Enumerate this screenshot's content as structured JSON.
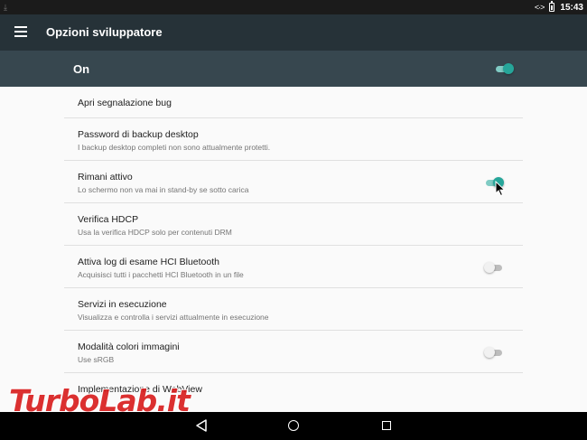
{
  "status_bar": {
    "time": "15:43"
  },
  "toolbar": {
    "title": "Opzioni sviluppatore"
  },
  "master_switch": {
    "label": "On",
    "state": "on"
  },
  "items": [
    {
      "title": "Apri segnalazione bug",
      "subtitle": ""
    },
    {
      "title": "Password di backup desktop",
      "subtitle": "I backup desktop completi non sono attualmente protetti."
    },
    {
      "title": "Rimani attivo",
      "subtitle": "Lo schermo non va mai in stand-by se sotto carica",
      "toggle": "on"
    },
    {
      "title": "Verifica HDCP",
      "subtitle": "Usa la verifica HDCP solo per contenuti DRM"
    },
    {
      "title": "Attiva log di esame HCI Bluetooth",
      "subtitle": "Acquisisci tutti i pacchetti HCI Bluetooth in un file",
      "toggle": "off"
    },
    {
      "title": "Servizi in esecuzione",
      "subtitle": "Visualizza e controlla i servizi attualmente in esecuzione"
    },
    {
      "title": "Modalità colori immagini",
      "subtitle": "Use sRGB",
      "toggle": "off"
    },
    {
      "title": "Implementazione di WebView",
      "subtitle": ""
    }
  ],
  "watermark": {
    "text": "TurboLab.it"
  },
  "colors": {
    "toolbar": "#263238",
    "on_bar": "#37474f",
    "accent": "#26a69a",
    "watermark": "#d81b1b"
  }
}
